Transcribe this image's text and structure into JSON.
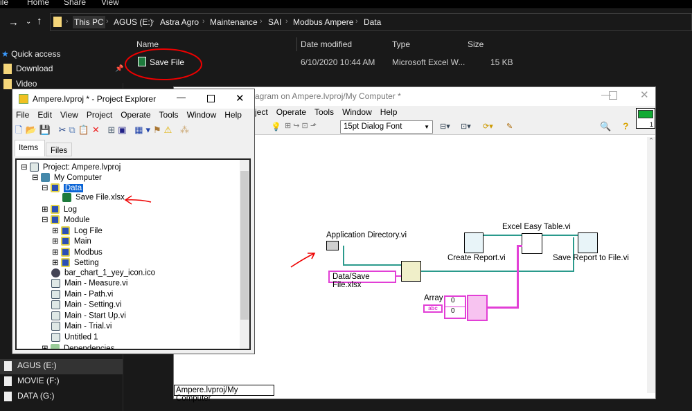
{
  "explorer": {
    "ribbon_tabs": [
      "ile",
      "Home",
      "Share",
      "View"
    ],
    "breadcrumb": [
      "This PC",
      "AGUS (E:)",
      "Astra Agro",
      "Maintenance",
      "SAI",
      "Modbus Ampere",
      "Data"
    ],
    "columns": [
      "Name",
      "Date modified",
      "Type",
      "Size"
    ],
    "file": {
      "name": "Save File",
      "date": "6/10/2020 10:44 AM",
      "type": "Microsoft Excel W...",
      "size": "15 KB"
    },
    "nav": {
      "quick_access": "Quick access",
      "items": [
        "Download",
        "Video"
      ],
      "drives": [
        "AGUS (E:)",
        "MOVIE (F:)",
        "DATA (G:)"
      ]
    }
  },
  "project": {
    "title": "Ampere.lvproj * - Project Explorer",
    "menu": [
      "File",
      "Edit",
      "View",
      "Project",
      "Operate",
      "Tools",
      "Window",
      "Help"
    ],
    "tabs": [
      "Items",
      "Files"
    ],
    "tree": [
      "Project: Ampere.lvproj",
      "My Computer",
      "Data",
      "Save File.xlsx",
      "Log",
      "Module",
      "Log File",
      "Main",
      "Modbus",
      "Setting",
      "bar_chart_1_yey_icon.ico",
      "Main - Measure.vi",
      "Main - Path.vi",
      "Main - Setting.vi",
      "Main - Start Up.vi",
      "Main - Trial.vi",
      "Untitled 1",
      "Dependencies"
    ]
  },
  "diagram": {
    "title": "agram on Ampere.lvproj/My Computer *",
    "menu": [
      "ject",
      "Operate",
      "Tools",
      "Window",
      "Help"
    ],
    "font": "15pt Dialog Font",
    "icon_number": "1",
    "nodes": {
      "app_dir": "Application Directory.vi",
      "path_const": "Data/Save File.xlsx",
      "create": "Create Report.vi",
      "excel": "Excel Easy Table.vi",
      "save": "Save Report to File.vi",
      "array": "Array",
      "array_idx": [
        "0",
        "0"
      ],
      "abc": "abc"
    },
    "status": "Ampere.lvproj/My Computer"
  }
}
